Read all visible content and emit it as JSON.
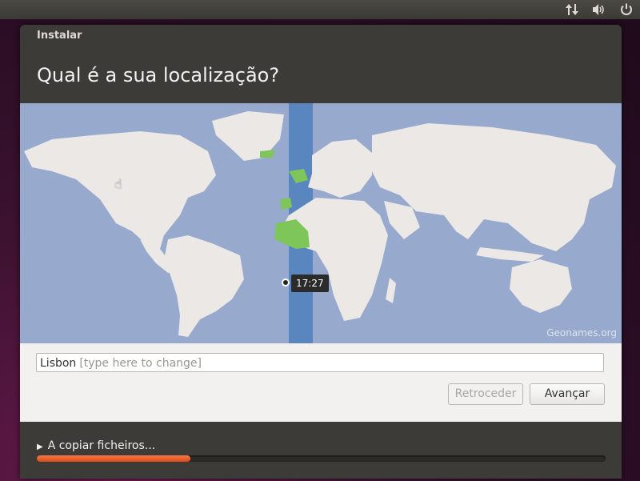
{
  "topbar": {
    "icons": [
      "network-arrows-icon",
      "volume-icon",
      "power-icon"
    ]
  },
  "window": {
    "title": "Instalar",
    "heading": "Qual é a sua localização?"
  },
  "map": {
    "time_label": "17:27",
    "credit": "Geonames.org",
    "colors": {
      "ocean": "#97a9cd",
      "land": "#ebe8e6",
      "timezone_band": "#5a86c0",
      "selected_zone": "#7fc65a"
    }
  },
  "location": {
    "value": "Lisbon",
    "placeholder": "[type here to change]"
  },
  "buttons": {
    "back": "Retroceder",
    "next": "Avançar"
  },
  "progress": {
    "label": "A copiar ficheiros...",
    "fraction": 0.27,
    "color": "#dd4814"
  }
}
